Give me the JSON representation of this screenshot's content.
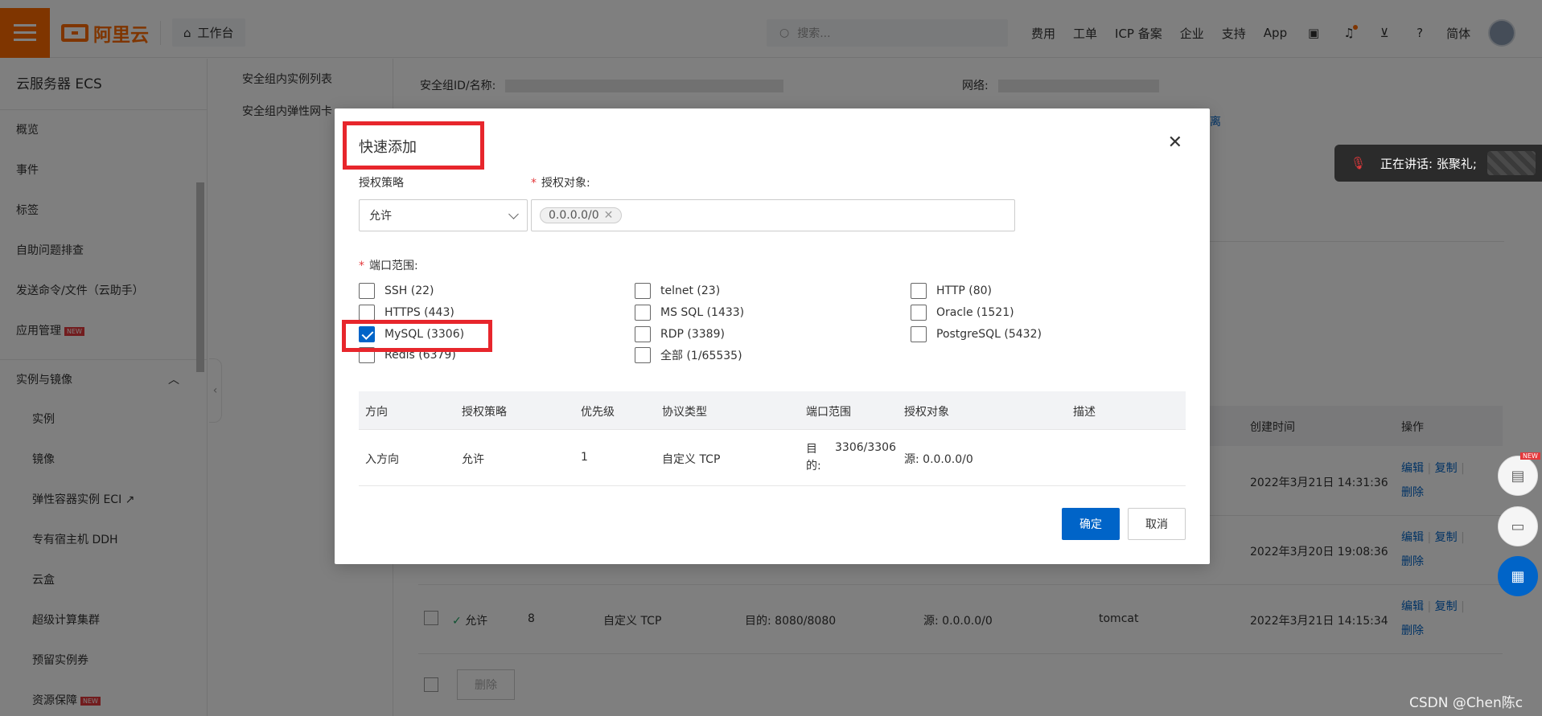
{
  "header": {
    "logo_text": "阿里云",
    "workbench": "工作台",
    "search_placeholder": "搜索...",
    "nav": [
      "费用",
      "工单",
      "ICP 备案",
      "企业",
      "支持",
      "App"
    ],
    "lang": "简体"
  },
  "sidebar": {
    "title": "云服务器 ECS",
    "items": [
      "概览",
      "事件",
      "标签",
      "自助问题排查",
      "发送命令/文件（云助手）",
      "应用管理"
    ],
    "group": "实例与镜像",
    "sub_items": [
      "实例",
      "镜像",
      "弹性容器实例 ECI",
      "专有宿主机 DDH",
      "云盒",
      "超级计算集群",
      "预留实例券",
      "资源保障"
    ],
    "new_badge": "NEW"
  },
  "subnav": {
    "items": [
      "安全组内实例列表",
      "安全组内弹性网卡"
    ]
  },
  "background": {
    "sg_label": "安全组ID/名称:",
    "network_label": "网络:",
    "link_fragment": "离",
    "table_headers": {
      "created": "创建时间",
      "ops": "操作"
    },
    "rows": [
      {
        "created": "2022年3月21日 14:31:36"
      },
      {
        "created": "2022年3月20日 19:08:36"
      },
      {
        "policy": "允许",
        "priority": "8",
        "protocol": "自定义 TCP",
        "port": "目的: 8080/8080",
        "source": "源: 0.0.0.0/0",
        "desc": "tomcat",
        "created": "2022年3月21日 14:15:34"
      }
    ],
    "op_edit": "编辑",
    "op_copy": "复制",
    "op_delete": "删除",
    "delete_btn": "删除"
  },
  "call": {
    "text": "正在讲话: 张聚礼;"
  },
  "watermark": "CSDN @Chen陈c",
  "fab_new": "NEW",
  "modal": {
    "title": "快速添加",
    "policy_label": "授权策略",
    "policy_value": "允许",
    "target_label": "授权对象:",
    "target_tag": "0.0.0.0/0",
    "port_label": "端口范围:",
    "ports": [
      {
        "label": "SSH (22)",
        "checked": false
      },
      {
        "label": "telnet (23)",
        "checked": false
      },
      {
        "label": "HTTP (80)",
        "checked": false
      },
      {
        "label": "HTTPS (443)",
        "checked": false
      },
      {
        "label": "MS SQL (1433)",
        "checked": false
      },
      {
        "label": "Oracle (1521)",
        "checked": false
      },
      {
        "label": "MySQL (3306)",
        "checked": true
      },
      {
        "label": "RDP (3389)",
        "checked": false
      },
      {
        "label": "PostgreSQL (5432)",
        "checked": false
      },
      {
        "label": "Redis (6379)",
        "checked": false
      },
      {
        "label": "全部 (1/65535)",
        "checked": false
      }
    ],
    "table": {
      "headers": [
        "方向",
        "授权策略",
        "优先级",
        "协议类型",
        "端口范围",
        "授权对象",
        "描述"
      ],
      "row": {
        "direction": "入方向",
        "policy": "允许",
        "priority": "1",
        "protocol": "自定义 TCP",
        "port_prefix": "目的:",
        "port_value": "3306/3306",
        "source": "源: 0.0.0.0/0",
        "desc": ""
      }
    },
    "confirm": "确定",
    "cancel": "取消"
  }
}
